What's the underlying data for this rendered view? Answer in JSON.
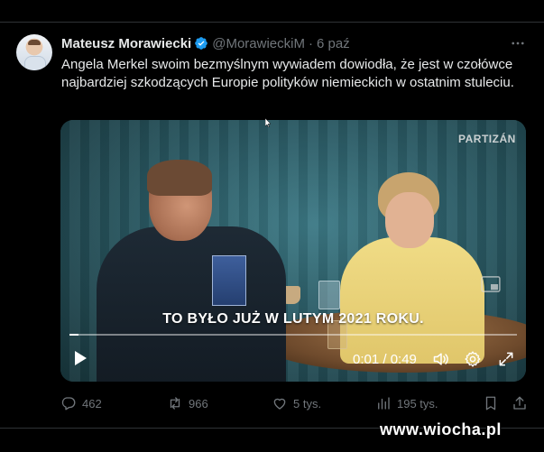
{
  "tweet": {
    "author_name": "Mateusz Morawiecki",
    "handle": "@MorawieckiM",
    "separator": "·",
    "time": "6 paź",
    "text": "Angela Merkel swoim bezmyślnym wywiadem dowiodła, że jest w czołówce najbardziej szkodzących Europie polityków niemieckich w ostatnim stuleciu."
  },
  "video": {
    "watermark": "PARTIZÁN",
    "subtitle": "TO BYŁO JUŻ W LUTYM 2021 ROKU.",
    "timecode": "0:01 / 0:49",
    "progress_fraction": 0.02,
    "book_title": "ANGELA MERKEL SZABADSÁG"
  },
  "actions": {
    "replies": "462",
    "reposts": "966",
    "likes": "5 tys.",
    "views": "195 tys."
  },
  "site_watermark": "www.wiocha.pl",
  "colors": {
    "background": "#000000",
    "text": "#e7e9ea",
    "muted": "#71767b",
    "verified": "#1d9bf0"
  }
}
